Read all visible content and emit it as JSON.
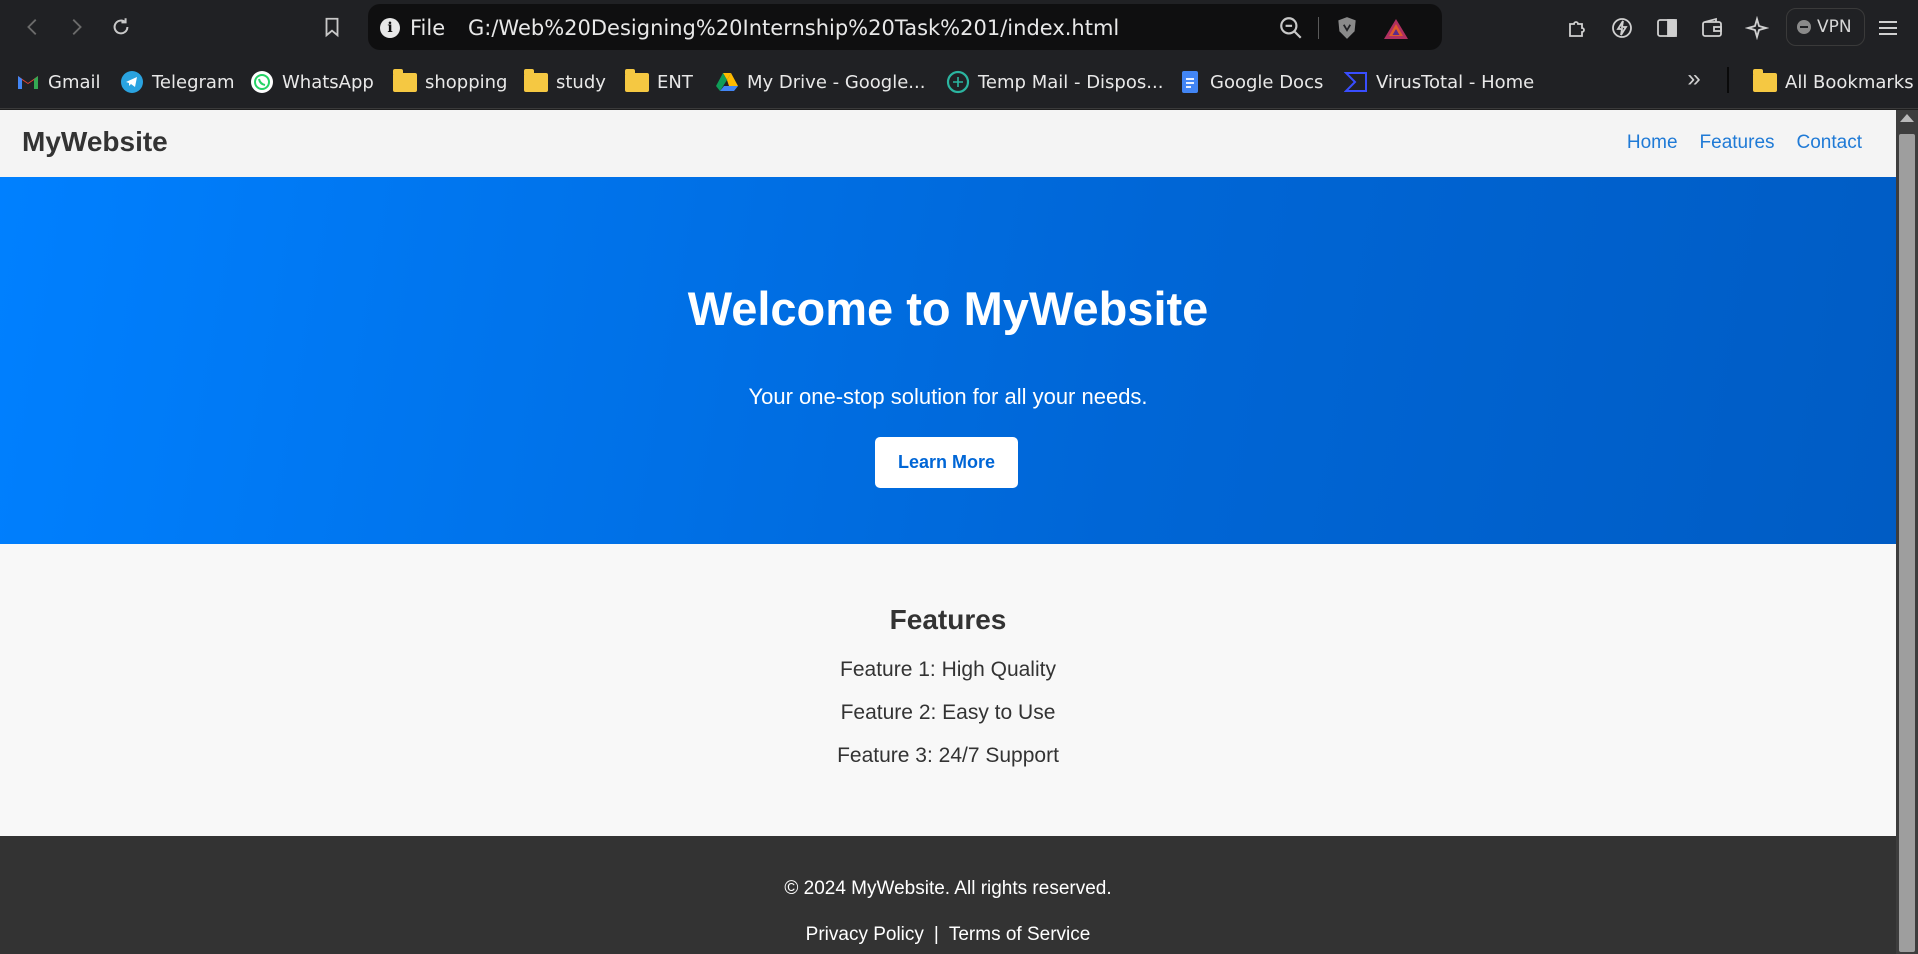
{
  "browser": {
    "url_scheme": "File",
    "url": "G:/Web%20Designing%20Internship%20Task%201/index.html",
    "vpn_label": "VPN",
    "bookmarks": [
      {
        "label": "Gmail",
        "icon": "gmail-icon"
      },
      {
        "label": "Telegram",
        "icon": "telegram-icon"
      },
      {
        "label": "WhatsApp",
        "icon": "whatsapp-icon"
      },
      {
        "label": "shopping",
        "icon": "folder-icon"
      },
      {
        "label": "study",
        "icon": "folder-icon"
      },
      {
        "label": "ENT",
        "icon": "folder-icon"
      },
      {
        "label": "My Drive - Google...",
        "icon": "google-drive-icon"
      },
      {
        "label": "Temp Mail - Dispos...",
        "icon": "temp-mail-icon"
      },
      {
        "label": "Google Docs",
        "icon": "google-docs-icon"
      },
      {
        "label": "VirusTotal - Home",
        "icon": "virustotal-icon"
      }
    ],
    "all_bookmarks_label": "All Bookmarks",
    "colors": {
      "chrome_bg": "#202124",
      "urlbar_bg": "#0f0f10",
      "folder": "#f5c842"
    }
  },
  "site": {
    "brand": "MyWebsite",
    "nav": [
      "Home",
      "Features",
      "Contact"
    ],
    "hero": {
      "title": "Welcome to MyWebsite",
      "subtitle": "Your one-stop solution for all your needs.",
      "button_label": "Learn More"
    },
    "features": {
      "title": "Features",
      "items": [
        "Feature 1: High Quality",
        "Feature 2: Easy to Use",
        "Feature 3: 24/7 Support"
      ]
    },
    "footer": {
      "copyright": "© 2024 MyWebsite. All rights reserved.",
      "links": [
        "Privacy Policy",
        "Terms of Service"
      ],
      "separator": "|"
    },
    "colors": {
      "accent": "#1f7ad6",
      "hero_start": "#0080ff",
      "hero_end": "#005cc4",
      "footer_bg": "#333333",
      "text": "#333333"
    }
  }
}
